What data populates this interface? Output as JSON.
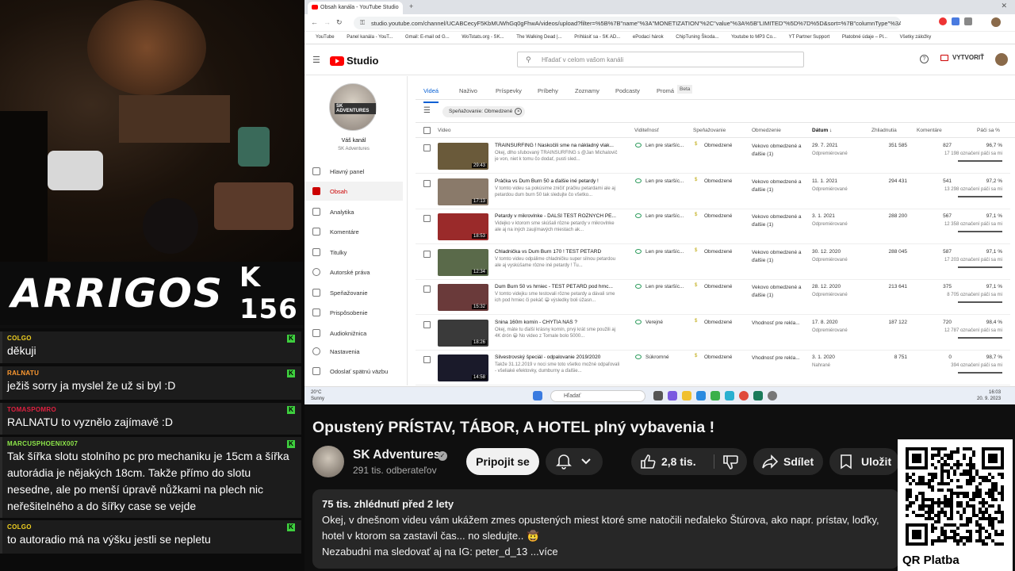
{
  "stream": {
    "logo_name": "ARRIGOS",
    "logo_number": "K 156"
  },
  "chat": [
    {
      "user": "COLGO",
      "color": "#f0d020",
      "text": "děkuji"
    },
    {
      "user": "RALNATU",
      "color": "#ff9a30",
      "text": "ježiš sorry ja myslel že už si byl :D"
    },
    {
      "user": "TOMASPOMRO",
      "color": "#e02040",
      "text": "RALNATU to vyznělo zajímavě :D"
    },
    {
      "user": "MARCUSPHOENIX007",
      "color": "#8ee84a",
      "text": "Tak šířka slotu stolního pc pro mechaniku je 15cm a šířka autorádia je nějakých 18cm. Takže přímo do slotu nesedne, ale po menší úpravě nůžkami na plech nic neřešitelného a do šířky case se vejde"
    },
    {
      "user": "COLGO",
      "color": "#f0d020",
      "text": "to autoradio má na výšku jestli se nepletu"
    }
  ],
  "browser": {
    "tab_title": "Obsah kanála - YouTube Studio",
    "url": "studio.youtube.com/channel/UCABCecyF5KbMUWhGq0gFhwA/videos/upload?filter=%5B%7B\"name\"%3A\"MONETIZATION\"%2C\"value\"%3A%5B\"LIMITED\"%5D%7D%5D&sort=%7B\"columnType\"%3A\"dat...",
    "bookmarks": [
      "YouTube",
      "Panel kanála - YouT...",
      "Gmail: E-mail od G...",
      "WoTstats.org - SK...",
      "The Walking Dead |...",
      "Prihlásiť sa - SK AD...",
      "ePodací hárok",
      "ChipTuning Škoda...",
      "Youtube to MP3 Co...",
      "YT Partner Support",
      "Platobné údaje – Pl...",
      "Všetky záložky"
    ]
  },
  "studio": {
    "logo": "Studio",
    "search_placeholder": "Hľadať v celom vašom kanáli",
    "create_label": "VYTVORIŤ",
    "channel_label": "Váš kanál",
    "channel_name": "SK Adventures",
    "channel_badge": "SK ADVENTURES",
    "nav": [
      "Hlavný panel",
      "Obsah",
      "Analytika",
      "Komentáre",
      "Titulky",
      "Autorské práva",
      "Speňažovanie",
      "Prispôsobenie",
      "Audioknižnica",
      "Nastavenia",
      "Odoslať spätnú väzbu"
    ],
    "tabs": [
      "Videá",
      "Naživo",
      "Príspevky",
      "Príbehy",
      "Zoznamy",
      "Podcasty",
      "Promá",
      "Beta"
    ],
    "filter_chip": "Speňažovanie: Obmedzené",
    "columns": [
      "Video",
      "Viditeľnosť",
      "Speňažovanie",
      "Obmedzenie",
      "Dátum ↓",
      "Zhliadnutia",
      "Komentáre",
      "Páči sa %"
    ],
    "rows": [
      {
        "title": "TRAINSURFING ! Naskočili sme na nákladný vlak...",
        "desc": "Okej, dlho sľubovaný TRAINSURFING s @Jan Michalovič je von, niet k tomu čo dodať, pusti sled...",
        "duration": "29:43",
        "visibility": "Len pre staršíc...",
        "monetization": "Obmedzené",
        "restriction": "Vekovo obmedzené a ďalšie (1)",
        "date": "29. 7. 2021",
        "date_sub": "Odpremiérované",
        "views": "351 585",
        "comments": "827",
        "likes_pct": "96,7 %",
        "likes_sub": "17 198 označení páči sa mi",
        "thumb": "#6a5a3a"
      },
      {
        "title": "Práčka vs Dum Burn 50 a ďalšie iné petardy !",
        "desc": "V tomto videu sa pokúsime zničiť práčku petardami ale aj petardou dum burn 50 tak sledujte čo všetko...",
        "duration": "17:13",
        "visibility": "Len pre staršíc...",
        "monetization": "Obmedzené",
        "restriction": "Vekovo obmedzené a ďalšie (1)",
        "date": "11. 1. 2021",
        "date_sub": "Odpremiérované",
        "views": "294 431",
        "comments": "541",
        "likes_pct": "97,2 %",
        "likes_sub": "13 298 označení páči sa mi",
        "thumb": "#8a7a6a"
      },
      {
        "title": "Petardy v mikrovlnke - ĎALŠÍ TEST RÔZNYCH PE...",
        "desc": "Videjko v ktorom sme skúšali rôzne petardy v mikrovlnke ale aj na iných zaujímavých miestach ak...",
        "duration": "18:53",
        "visibility": "Len pre staršíc...",
        "monetization": "Obmedzené",
        "restriction": "Vekovo obmedzené a ďalšie (1)",
        "date": "3. 1. 2021",
        "date_sub": "Odpremiérované",
        "views": "288 200",
        "comments": "567",
        "likes_pct": "97,1 %",
        "likes_sub": "12 358 označení páči sa mi",
        "thumb": "#9a2a2a"
      },
      {
        "title": "Chladnička vs Dum Burn 170 ! TEST PETÁRD",
        "desc": "V tomto videu odpálime chladničku super silnou petardou ale aj vyskúšame rôzne iné petardy ! Tu...",
        "duration": "12:34",
        "visibility": "Len pre staršíc...",
        "monetization": "Obmedzené",
        "restriction": "Vekovo obmedzené a ďalšie (1)",
        "date": "30. 12. 2020",
        "date_sub": "Odpremiérované",
        "views": "288 045",
        "comments": "587",
        "likes_pct": "97,1 %",
        "likes_sub": "17 203 označení páči sa mi",
        "thumb": "#5a6a4a"
      },
      {
        "title": "Dum Burn 50 vs hrniec - TEST PETÁRD pod hrnc...",
        "desc": "V tomto videjku sme testovali rôzne petardy a dávali sme ich pod hrniec či pekáč 😁 výsledky boli úžasn...",
        "duration": "15:32",
        "visibility": "Len pre staršíc...",
        "monetization": "Obmedzené",
        "restriction": "Vekovo obmedzené a ďalšie (1)",
        "date": "28. 12. 2020",
        "date_sub": "Odpremiérované",
        "views": "213 641",
        "comments": "375",
        "likes_pct": "97,1 %",
        "likes_sub": "8 705 označení páči sa mi",
        "thumb": "#6a3a3a"
      },
      {
        "title": "Snina 160m komín - CHYTIA NÁS ?",
        "desc": "Okej, máte tu ďalší krásny komín, prvý krát sme použili aj 4K drón 😁 No video z Tornale bolo 5000...",
        "duration": "18:26",
        "visibility": "Verejné",
        "monetization": "Obmedzené",
        "restriction": "Vhodnosť pre rekla...",
        "date": "17. 8. 2020",
        "date_sub": "Odpremiérované",
        "views": "187 122",
        "comments": "720",
        "likes_pct": "98,4 %",
        "likes_sub": "12 787 označení páči sa mi",
        "thumb": "#3a3a3a"
      },
      {
        "title": "Silvestrovský špeciál - odpalovanie 2019/2020",
        "desc": "Takže 31.12.2019 v noci sme toto všetko možné odpaľovali - všeliaké efektovky, dumburny a ďalšie...",
        "duration": "14:58",
        "visibility": "Súkromné",
        "monetization": "Obmedzené",
        "restriction": "Vhodnosť pre rekla...",
        "date": "3. 1. 2020",
        "date_sub": "Nahrané",
        "views": "8 751",
        "comments": "0",
        "likes_pct": "98,7 %",
        "likes_sub": "394 označení páči sa mi",
        "thumb": "#1a1a2a"
      }
    ]
  },
  "taskbar": {
    "temp": "20°C",
    "weather": "Sunny",
    "search": "Hľadať",
    "time": "16:03",
    "date": "20. 9. 2023"
  },
  "video": {
    "title": "Opustený PRÍSTAV, TÁBOR, A HOTEL plný vybavenia !",
    "channel": "SK Adventures",
    "subscribers": "291 tis. odberateľov",
    "subscribe_label": "Pripojit se",
    "likes": "2,8 tis.",
    "share_label": "Sdílet",
    "save_label": "Uložit",
    "views_meta": "75 tis. zhlédnutí  před 2 lety",
    "desc_line1": "Okej, v dnešnom videu vám ukážem zmes opustených miest ktoré sme natočili neďaleko Štúrova, ako napr. prístav, loďky,",
    "desc_line2": "hotel v ktorom sa zastavil čas... no sledujte.. 🤠",
    "desc_line3": "Nezabudni ma sledovať aj na IG: peter_d_13  ...více"
  },
  "qr_label": "QR Platba"
}
